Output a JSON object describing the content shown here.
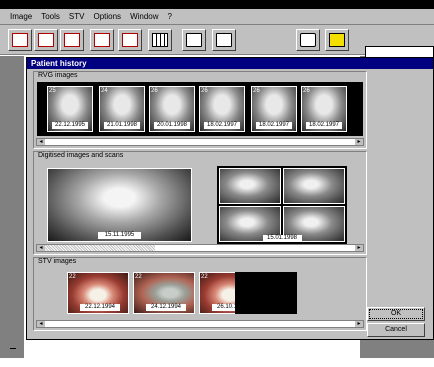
{
  "menu": [
    "Image",
    "Tools",
    "STV",
    "Options",
    "Window",
    "?"
  ],
  "dialog": {
    "title": "Patient history",
    "rvg_label": "RVG images",
    "digital_label": "Digitised images and scans",
    "stv_label": "STV images",
    "ok_label": "OK",
    "cancel_label": "Cancel"
  },
  "rvg": [
    {
      "num": "25",
      "date": "22.12.1995"
    },
    {
      "num": "24",
      "date": "21.01.1998"
    },
    {
      "num": "26",
      "date": "20.01.1998"
    },
    {
      "num": "26",
      "date": "18.02.1997"
    },
    {
      "num": "26",
      "date": "18.02.1997"
    },
    {
      "num": "26",
      "date": "18.02.1997"
    }
  ],
  "digital": [
    {
      "date": "15.11.1995"
    },
    {
      "date": "15.01.1998"
    }
  ],
  "stv": [
    {
      "num": "22",
      "date": "22.12.1994"
    },
    {
      "num": "22",
      "date": "24.12.1994"
    },
    {
      "num": "22",
      "date": "26.10.1998"
    }
  ],
  "icons": [
    "layout-1-icon",
    "layout-2-icon",
    "layout-4-icon",
    "layout-grid-icon",
    "layout-strip-icon",
    "layout-film-icon",
    "monitor-icon",
    "monitor-print-icon",
    "briefcase-icon",
    "exit-icon"
  ]
}
